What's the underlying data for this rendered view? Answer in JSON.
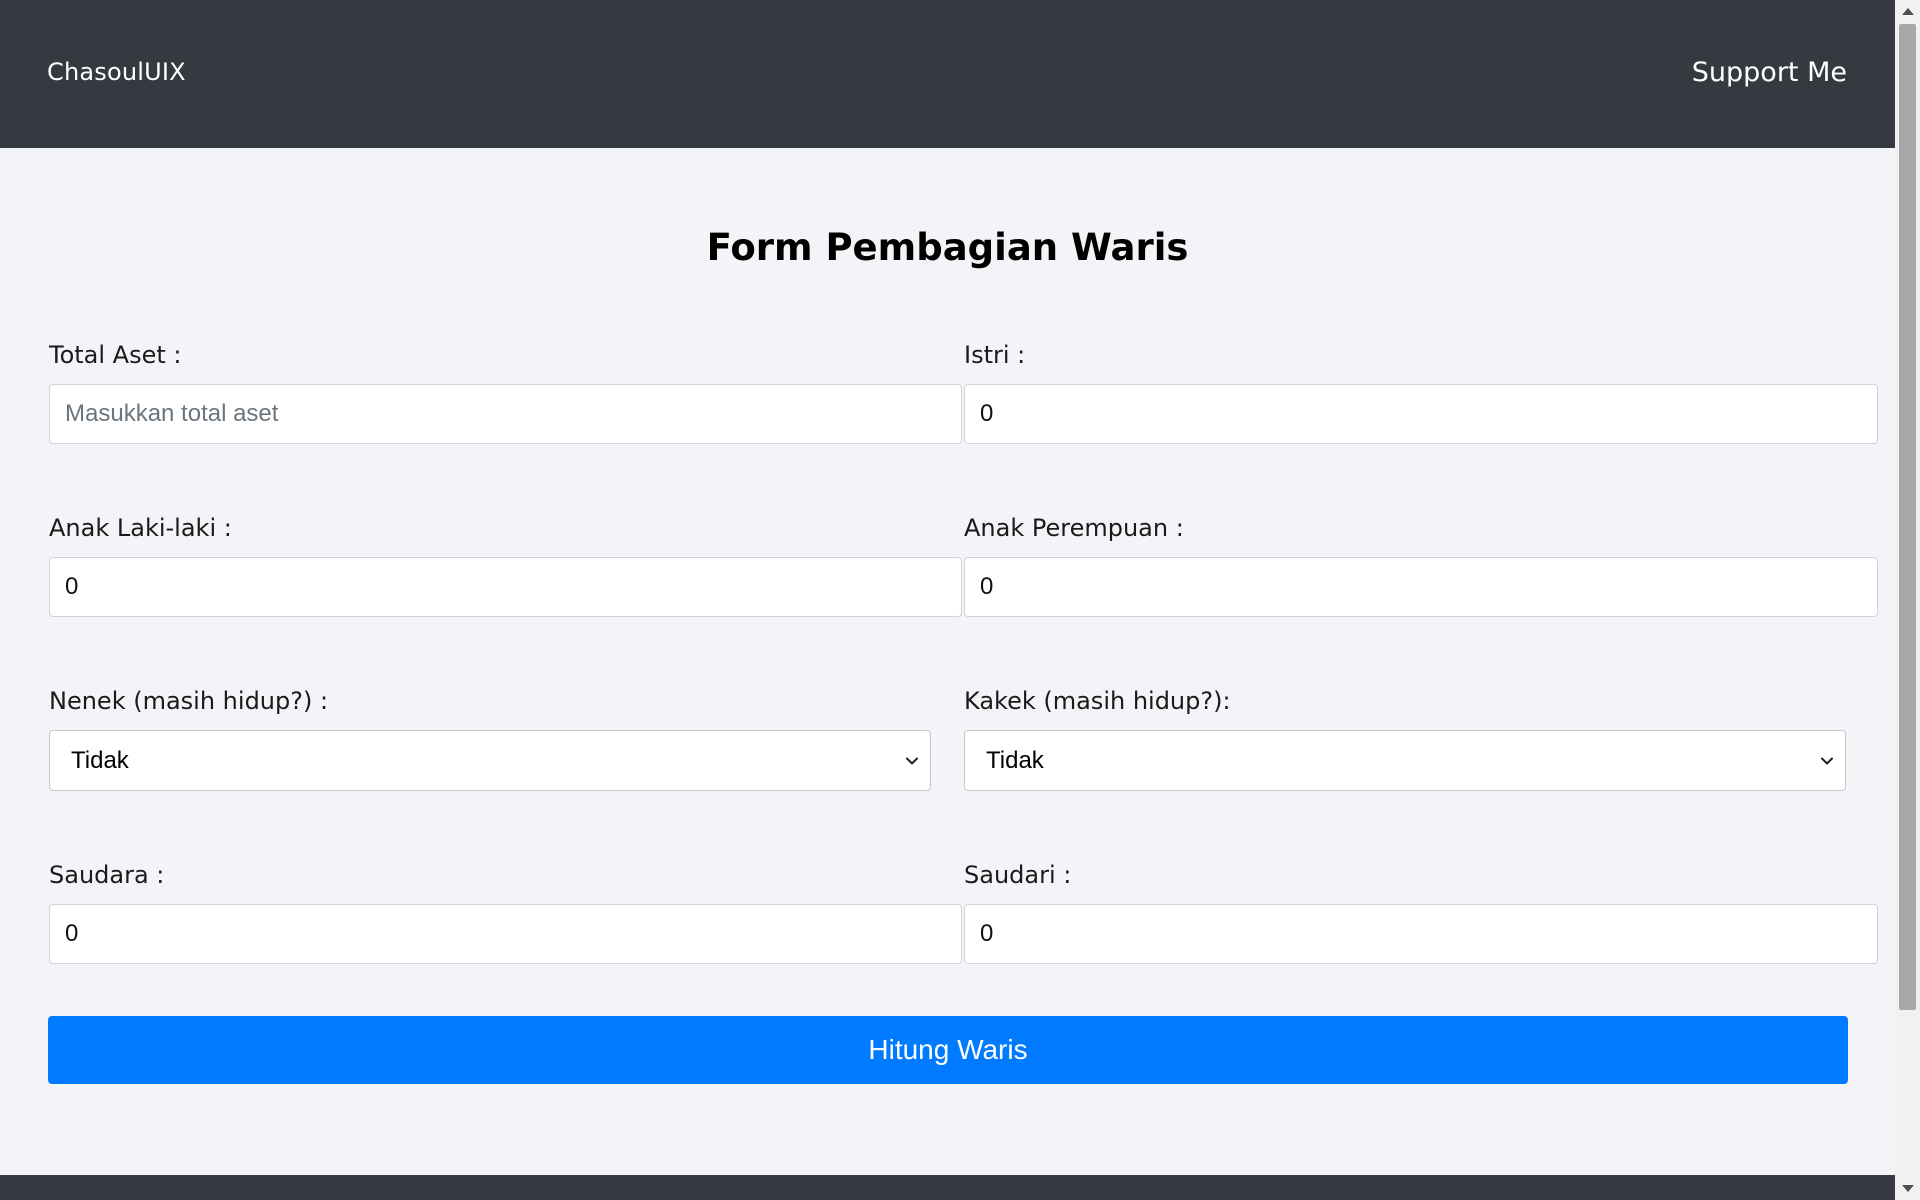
{
  "navbar": {
    "brand": "ChasoulUIX",
    "support_link": "Support Me"
  },
  "form": {
    "title": "Form Pembagian Waris",
    "total_aset": {
      "label": "Total Aset :",
      "value": "",
      "placeholder": "Masukkan total aset"
    },
    "istri": {
      "label": "Istri :",
      "value": "0"
    },
    "anak_laki": {
      "label": "Anak Laki-laki :",
      "value": "0"
    },
    "anak_perempuan": {
      "label": "Anak Perempuan :",
      "value": "0"
    },
    "nenek": {
      "label": "Nenek (masih hidup?) :",
      "selected": "Tidak"
    },
    "kakek": {
      "label": "Kakek (masih hidup?):",
      "selected": "Tidak"
    },
    "saudara": {
      "label": "Saudara :",
      "value": "0"
    },
    "saudari": {
      "label": "Saudari :",
      "value": "0"
    },
    "submit_label": "Hitung Waris"
  },
  "colors": {
    "navbar_bg": "#343a40",
    "page_bg": "#f3f4f7",
    "primary_button": "#007bff"
  }
}
